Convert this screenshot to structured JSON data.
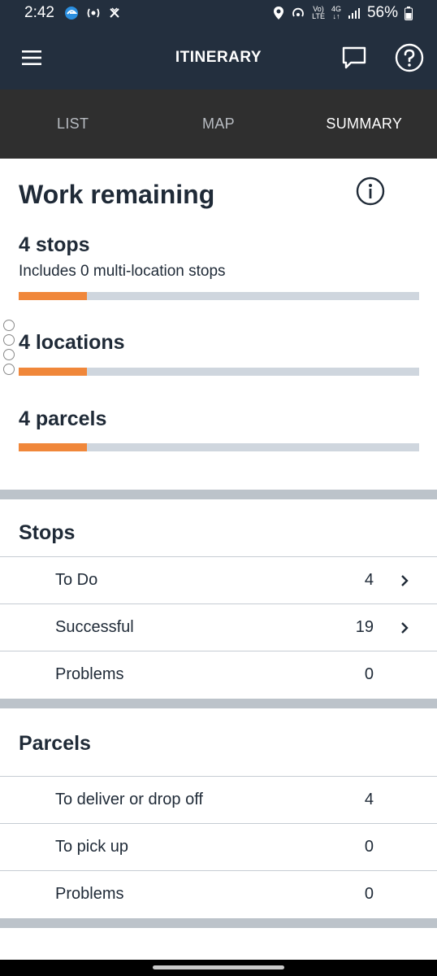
{
  "status_bar": {
    "time": "2:42",
    "network_label_top": "Vo)",
    "network_label_bottom": "LTE",
    "signal_top": "4G",
    "signal_bottom": "↓↑",
    "battery": "56%"
  },
  "app_bar": {
    "title": "ITINERARY",
    "icons": [
      "menu-icon",
      "chat-icon",
      "help-icon"
    ]
  },
  "tabs": [
    {
      "label": "LIST",
      "active": false
    },
    {
      "label": "MAP",
      "active": false
    },
    {
      "label": "SUMMARY",
      "active": true
    }
  ],
  "work_remaining": {
    "title": "Work remaining",
    "stops": {
      "label": "4 stops",
      "subtext": "Includes 0 multi-location stops",
      "progress_pct": 17
    },
    "locations": {
      "label": "4 locations",
      "progress_pct": 17
    },
    "parcels": {
      "label": "4 parcels",
      "progress_pct": 17
    }
  },
  "stops_section": {
    "title": "Stops",
    "rows": [
      {
        "label": "To Do",
        "count": "4",
        "chevron": true
      },
      {
        "label": "Successful",
        "count": "19",
        "chevron": true
      },
      {
        "label": "Problems",
        "count": "0",
        "chevron": false
      }
    ]
  },
  "parcels_section": {
    "title": "Parcels",
    "rows": [
      {
        "label": "To deliver or drop off",
        "count": "4"
      },
      {
        "label": "To pick up",
        "count": "0"
      },
      {
        "label": "Problems",
        "count": "0"
      }
    ]
  },
  "colors": {
    "header_bg": "#232f3e",
    "tabs_bg": "#2f2f2f",
    "progress_fill": "#f0873a",
    "progress_track": "#cfd6de",
    "divider": "#bcc3ca"
  }
}
